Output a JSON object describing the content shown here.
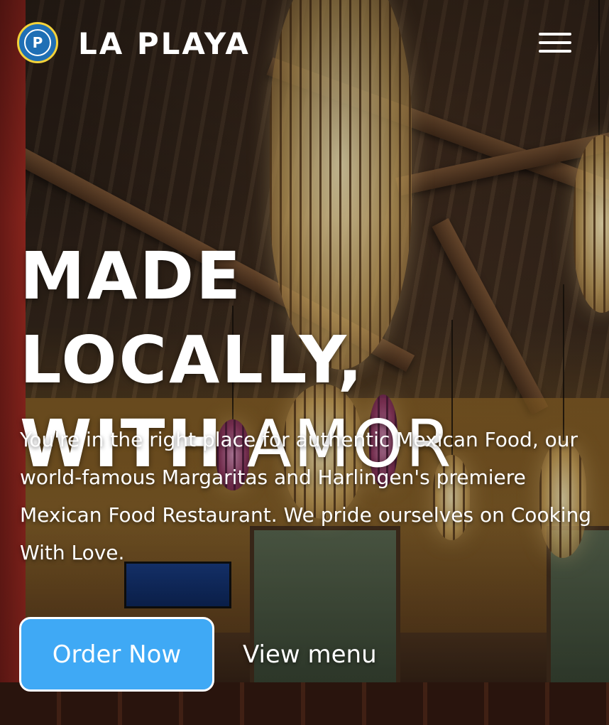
{
  "header": {
    "logo_letter": "P",
    "brand_name": "LA PLAYA",
    "menu_label": "Menu"
  },
  "hero": {
    "headline_line1": "MADE LOCALLY,",
    "headline_line2_bold": "WITH",
    "headline_line2_light": "AMOR",
    "intro": "You're in the right place for authentic Mexican Food, our world-famous Margaritas and Harlingen's premiere Mexican Food Restaurant. We pride ourselves on Cooking With Love."
  },
  "actions": {
    "order_label": "Order Now",
    "menu_link_label": "View menu"
  },
  "colors": {
    "accent": "#3fa9f5",
    "logo_blue": "#1f6fb5",
    "logo_ring": "#f3d23a",
    "text": "#ffffff"
  },
  "icons": {
    "menu": "hamburger-icon",
    "logo": "la-playa-logo"
  }
}
